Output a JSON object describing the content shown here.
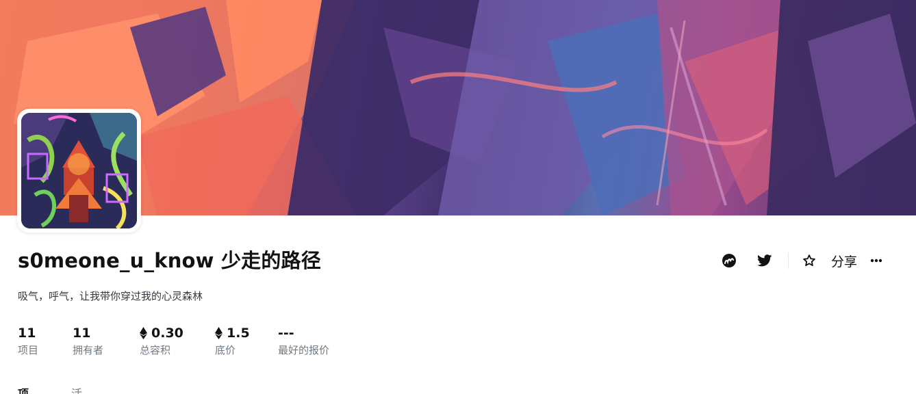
{
  "collection": {
    "title": "s0meone_u_know 少走的路径",
    "description": "吸气，呼气，让我带你穿过我的心灵森林"
  },
  "actions": {
    "website_icon": "opensea-activity-icon",
    "twitter_icon": "twitter-icon",
    "star_icon": "star-icon",
    "share_label": "分享",
    "more_icon": "more-icon"
  },
  "stats": [
    {
      "value": "11",
      "label": "项目",
      "eth": false
    },
    {
      "value": "11",
      "label": "拥有者",
      "eth": false
    },
    {
      "value": "0.30",
      "label": "总容积",
      "eth": true
    },
    {
      "value": "1.5",
      "label": "底价",
      "eth": true
    },
    {
      "value": "---",
      "label": "最好的报价",
      "eth": false
    }
  ],
  "tabs": [
    {
      "label": "项"
    },
    {
      "label": "活"
    }
  ]
}
